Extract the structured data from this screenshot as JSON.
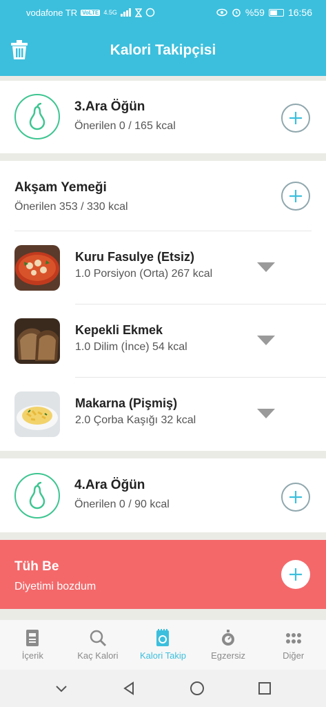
{
  "status_bar": {
    "carrier": "vodafone TR",
    "volte": "VoLTE",
    "network": "4.5G",
    "battery": "%59",
    "time": "16:56"
  },
  "header": {
    "title": "Kalori Takipçisi"
  },
  "meals": {
    "ara3": {
      "title": "3.Ara Öğün",
      "subtitle": "Önerilen 0 / 165 kcal"
    },
    "aksam": {
      "title": "Akşam Yemeği",
      "subtitle": "Önerilen 353 / 330 kcal",
      "foods": [
        {
          "name": "Kuru Fasulye (Etsiz)",
          "detail": "1.0 Porsiyon (Orta) 267 kcal"
        },
        {
          "name": "Kepekli Ekmek",
          "detail": "1.0 Dilim (İnce) 54 kcal"
        },
        {
          "name": "Makarna (Pişmiş)",
          "detail": "2.0 Çorba Kaşığı 32 kcal"
        }
      ]
    },
    "ara4": {
      "title": "4.Ara Öğün",
      "subtitle": "Önerilen 0 / 90 kcal"
    },
    "tuhbe": {
      "title": "Tüh Be",
      "subtitle": "Diyetimi bozdum"
    }
  },
  "nav": [
    {
      "label": "İçerik"
    },
    {
      "label": "Kaç Kalori"
    },
    {
      "label": "Kalori Takip"
    },
    {
      "label": "Egzersiz"
    },
    {
      "label": "Diğer"
    }
  ],
  "colors": {
    "accent": "#3cbfdd",
    "pear": "#3ec591",
    "alert": "#f4686a"
  }
}
